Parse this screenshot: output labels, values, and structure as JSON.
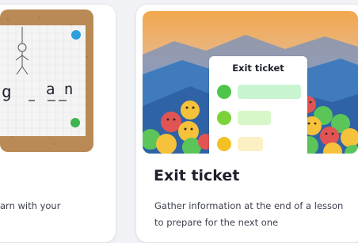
{
  "cards": [
    {
      "title": "",
      "description": "arn with your",
      "word_visible": [
        "g",
        "_",
        "a n"
      ],
      "colors": {
        "cork": "#b98a55",
        "paper": "#f4f4f4",
        "pin_blue": "#2c9fe0",
        "pin_green": "#3fb34f"
      }
    },
    {
      "title": "Exit ticket",
      "description": "Gather information at the end of a lesson to prepare for the next one",
      "ticket_title": "Exit ticket",
      "rows": [
        {
          "icon": "happy-face-icon",
          "color": "#4fc64a",
          "bar_color": "#c8f5d0"
        },
        {
          "icon": "neutral-face-icon",
          "color": "#7bd23a",
          "bar_color": "#d8f7c8"
        },
        {
          "icon": "worried-face-icon",
          "color": "#f4c023",
          "bar_color": "#fbf0c3"
        }
      ],
      "colors": {
        "sky_top": "#f2a84e",
        "mountain": "#3f7bbd",
        "emoji_red": "#e25454",
        "emoji_yellow": "#f6c23b",
        "emoji_green": "#5bc55a"
      }
    }
  ]
}
